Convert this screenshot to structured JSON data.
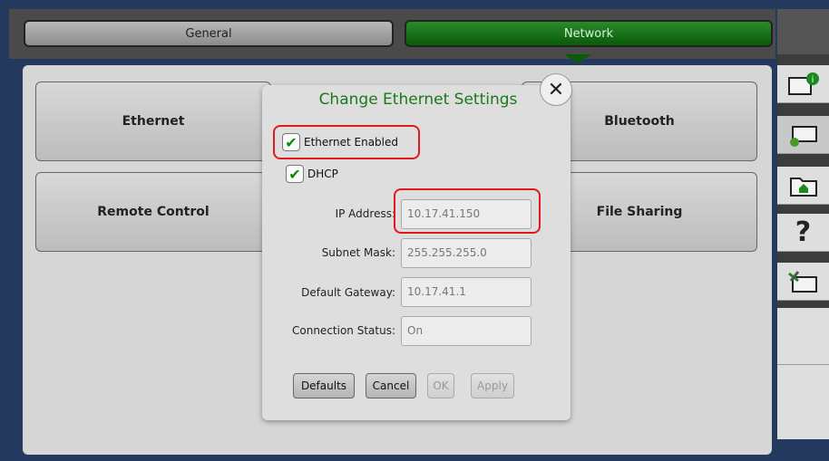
{
  "tabs": {
    "general": "General",
    "network": "Network"
  },
  "panels": {
    "ethernet": "Ethernet",
    "bluetooth": "Bluetooth",
    "remote_control": "Remote Control",
    "file_sharing": "File Sharing"
  },
  "sidebar": {
    "icons": [
      "info-icon",
      "settings-icon",
      "home-folder-icon",
      "help-icon",
      "tools-icon"
    ],
    "help_glyph": "?"
  },
  "dialog": {
    "title": "Change Ethernet Settings",
    "close_glyph": "✕",
    "ethernet_enabled": {
      "label": "Ethernet Enabled",
      "checked": true
    },
    "dhcp": {
      "label": "DHCP",
      "checked": true
    },
    "fields": {
      "ip": {
        "label": "IP Address:",
        "value": "10.17.41.150"
      },
      "subnet": {
        "label": "Subnet Mask:",
        "value": "255.255.255.0"
      },
      "gateway": {
        "label": "Default Gateway:",
        "value": "10.17.41.1"
      },
      "status": {
        "label": "Connection Status:",
        "value": "On"
      }
    },
    "buttons": {
      "defaults": "Defaults",
      "cancel": "Cancel",
      "ok": "OK",
      "apply": "Apply"
    },
    "check_glyph": "✔"
  },
  "colors": {
    "accent_green": "#1a7a1a",
    "highlight_red": "#e01a1a"
  }
}
